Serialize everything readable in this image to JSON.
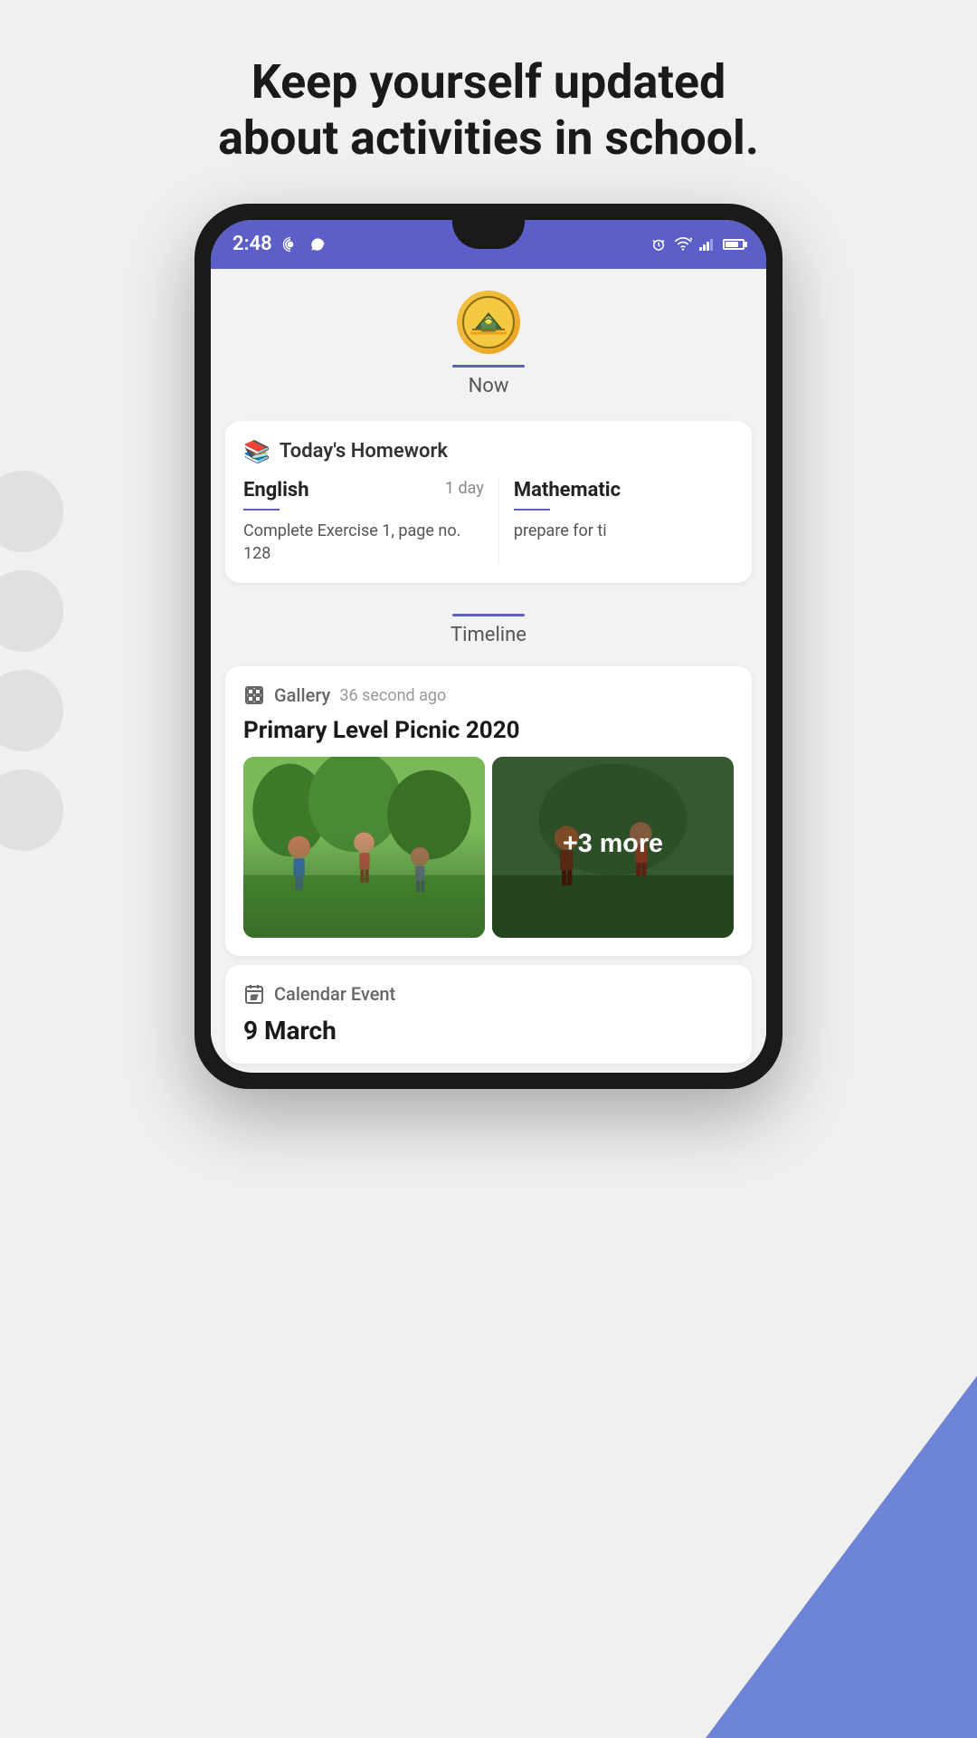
{
  "page": {
    "headline_line1": "Keep yourself updated",
    "headline_line2": "about activities in school."
  },
  "status_bar": {
    "time": "2:48",
    "icons": [
      "podcast",
      "whatsapp",
      "alarm",
      "wifi",
      "signal",
      "signal2",
      "battery"
    ]
  },
  "school_section": {
    "logo_emoji": "🏫",
    "tab_label": "Now"
  },
  "homework_card": {
    "title": "Today's Homework",
    "subjects": [
      {
        "name": "English",
        "due": "1 day",
        "description": "Complete Exercise 1, page no. 128"
      },
      {
        "name": "Mathematic",
        "due": "",
        "description": "prepare for ti"
      }
    ]
  },
  "timeline_section": {
    "tab_label": "Timeline"
  },
  "gallery_card": {
    "type": "Gallery",
    "time_ago": "36 second ago",
    "title": "Primary Level Picnic 2020",
    "more_count": "+3 more"
  },
  "calendar_card": {
    "type": "Calendar Event",
    "date": "9 March"
  },
  "bg_circles": [
    1,
    2,
    3,
    4
  ]
}
